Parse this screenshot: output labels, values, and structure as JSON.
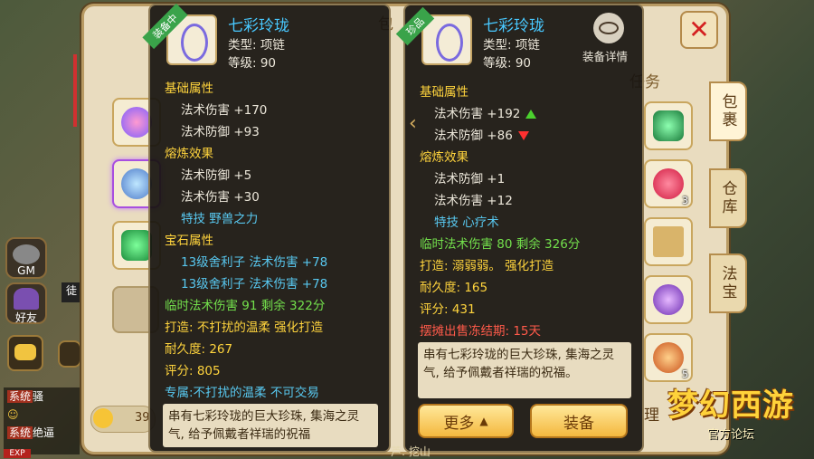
{
  "sidebar": {
    "gm_label": "GM",
    "friends_label": "好友",
    "chat_label_1": "系统",
    "chat_text_1": "骚",
    "chat_label_2": "系统",
    "chat_text_2": "绝逼",
    "exp_label": "EXP",
    "tu_label": "徒"
  },
  "bag": {
    "title_partial": "包",
    "tab_partial": "任务",
    "money_partial": "39",
    "tidy_partial": "理",
    "bottom_text": "芦: 挖山",
    "tabs": [
      "包裹",
      "仓库",
      "法宝"
    ],
    "counts": [
      "3",
      "5"
    ]
  },
  "equipped_tooltip": {
    "ribbon": "装备中",
    "name": "七彩玲珑",
    "type": "类型: 项链",
    "level": "等级: 90",
    "base_header": "基础属性",
    "base_stats": [
      "法术伤害 +170",
      "法术防御 +93"
    ],
    "refine_header": "熔炼效果",
    "refine_stats": [
      "法术防御 +5",
      "法术伤害 +30"
    ],
    "skill": "特技  野兽之力",
    "gem_header": "宝石属性",
    "gem_stats": [
      "13级舍利子  法术伤害 +78",
      "13级舍利子  法术伤害 +78"
    ],
    "temp_bonus": "临时法术伤害 91 剩余 322分",
    "forge": "打造: 不打扰的温柔    强化打造",
    "durability": "耐久度: 267",
    "score": "评分: 805",
    "exclusive": "专属:不打扰的温柔  不可交易",
    "description": "串有七彩玲珑的巨大珍珠, 集海之灵气, 给予佩戴者祥瑞的祝福"
  },
  "compare_tooltip": {
    "ribbon": "珍品",
    "name": "七彩玲珑",
    "type": "类型: 项链",
    "level": "等级: 90",
    "detail_label": "装备详情",
    "base_header": "基础属性",
    "base_stats": [
      "法术伤害 +192",
      "法术防御 +86"
    ],
    "refine_header": "熔炼效果",
    "refine_stats": [
      "法术防御 +1",
      "法术伤害 +12"
    ],
    "skill": "特技  心疗术",
    "temp_bonus": "临时法术伤害 80 剩余 326分",
    "forge": "打造: 溺弱弱。    强化打造",
    "durability": "耐久度: 165",
    "score": "评分: 431",
    "stall": "摆摊出售冻结期: 15天",
    "description": "串有七彩玲珑的巨大珍珠, 集海之灵气, 给予佩戴者祥瑞的祝福。",
    "more_button": "更多",
    "equip_button": "装备"
  },
  "logo": {
    "title": "梦幻西游",
    "subtitle": "官方论坛"
  }
}
